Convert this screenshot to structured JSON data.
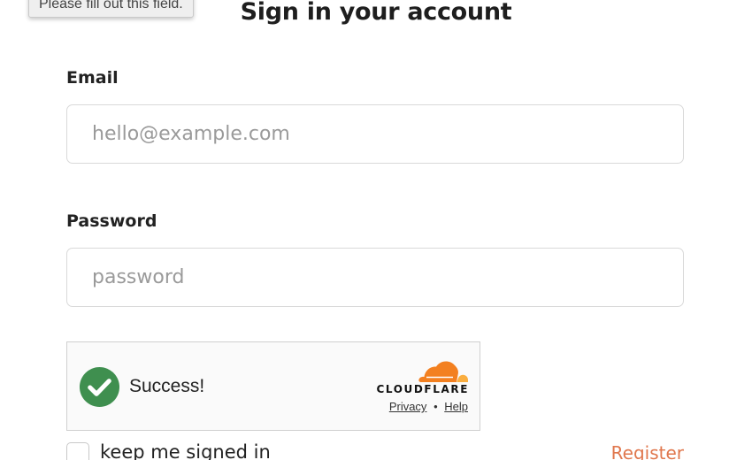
{
  "tooltip": {
    "text": "Please fill out this field."
  },
  "page": {
    "title": "Sign in your account"
  },
  "form": {
    "email_label": "Email",
    "email_placeholder": "hello@example.com",
    "email_value": "",
    "password_label": "Password",
    "password_placeholder": "password",
    "password_value": ""
  },
  "captcha": {
    "status_text": "Success!",
    "brand": "CLOUDFLARE",
    "privacy_label": "Privacy",
    "separator": "•",
    "help_label": "Help",
    "colors": {
      "success_green": "#3f8f4f",
      "cloud_orange": "#f38020",
      "cloud_light_orange": "#faae40"
    }
  },
  "footer": {
    "keep_signed_in_label": "keep me signed in",
    "register_label": "Register",
    "register_color": "#e0774d"
  },
  "icons": {
    "check": "check-circle-icon",
    "cloud": "cloudflare-cloud-icon"
  }
}
